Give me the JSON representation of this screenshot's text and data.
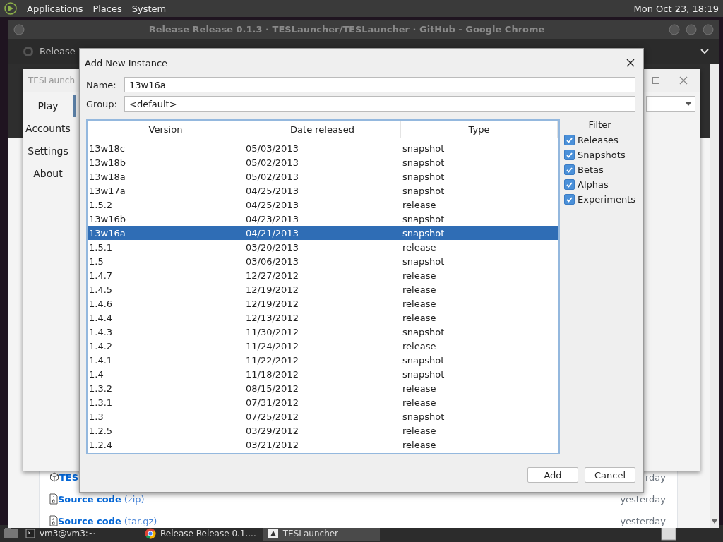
{
  "top_panel": {
    "menus": [
      "Applications",
      "Places",
      "System"
    ],
    "clock": "Mon Oct 23, 18:19"
  },
  "browser": {
    "title": "Release Release 0.1.3 · TESLauncher/TESLauncher · GitHub - Google Chrome",
    "tab": "Release",
    "assets": [
      {
        "kind": "package",
        "name": "TES",
        "time": "rday"
      },
      {
        "kind": "archive",
        "name": "Source code",
        "format": "(zip)",
        "time": "yesterday"
      },
      {
        "kind": "archive",
        "name": "Source code",
        "format": "(tar.gz)",
        "time": "yesterday"
      }
    ]
  },
  "launcher": {
    "title": "TESLaunch",
    "nav": [
      {
        "label": "Play",
        "selected": true
      },
      {
        "label": "Accounts",
        "selected": false
      },
      {
        "label": "Settings",
        "selected": false
      },
      {
        "label": "About",
        "selected": false
      }
    ]
  },
  "dialog": {
    "title": "Add New Instance",
    "fields": [
      {
        "label": "Name:",
        "value": "13w16a"
      },
      {
        "label": "Group:",
        "value": "<default>"
      }
    ],
    "table": {
      "columns": [
        "Version",
        "Date released",
        "Type"
      ],
      "rows": [
        {
          "cells": [
            "13w18c",
            "05/03/2013",
            "snapshot"
          ],
          "selected": false
        },
        {
          "cells": [
            "13w18b",
            "05/02/2013",
            "snapshot"
          ],
          "selected": false
        },
        {
          "cells": [
            "13w18a",
            "05/02/2013",
            "snapshot"
          ],
          "selected": false
        },
        {
          "cells": [
            "13w17a",
            "04/25/2013",
            "snapshot"
          ],
          "selected": false
        },
        {
          "cells": [
            "1.5.2",
            "04/25/2013",
            "release"
          ],
          "selected": false
        },
        {
          "cells": [
            "13w16b",
            "04/23/2013",
            "snapshot"
          ],
          "selected": false
        },
        {
          "cells": [
            "13w16a",
            "04/21/2013",
            "snapshot"
          ],
          "selected": true
        },
        {
          "cells": [
            "1.5.1",
            "03/20/2013",
            "release"
          ],
          "selected": false
        },
        {
          "cells": [
            "1.5",
            "03/06/2013",
            "snapshot"
          ],
          "selected": false
        },
        {
          "cells": [
            "1.4.7",
            "12/27/2012",
            "release"
          ],
          "selected": false
        },
        {
          "cells": [
            "1.4.5",
            "12/19/2012",
            "release"
          ],
          "selected": false
        },
        {
          "cells": [
            "1.4.6",
            "12/19/2012",
            "release"
          ],
          "selected": false
        },
        {
          "cells": [
            "1.4.4",
            "12/13/2012",
            "release"
          ],
          "selected": false
        },
        {
          "cells": [
            "1.4.3",
            "11/30/2012",
            "snapshot"
          ],
          "selected": false
        },
        {
          "cells": [
            "1.4.2",
            "11/24/2012",
            "release"
          ],
          "selected": false
        },
        {
          "cells": [
            "1.4.1",
            "11/22/2012",
            "snapshot"
          ],
          "selected": false
        },
        {
          "cells": [
            "1.4",
            "11/18/2012",
            "snapshot"
          ],
          "selected": false
        },
        {
          "cells": [
            "1.3.2",
            "08/15/2012",
            "release"
          ],
          "selected": false
        },
        {
          "cells": [
            "1.3.1",
            "07/31/2012",
            "release"
          ],
          "selected": false
        },
        {
          "cells": [
            "1.3",
            "07/25/2012",
            "snapshot"
          ],
          "selected": false
        },
        {
          "cells": [
            "1.2.5",
            "03/29/2012",
            "release"
          ],
          "selected": false
        },
        {
          "cells": [
            "1.2.4",
            "03/21/2012",
            "release"
          ],
          "selected": false
        }
      ]
    },
    "filter": {
      "title": "Filter",
      "options": [
        {
          "label": "Releases",
          "checked": true
        },
        {
          "label": "Snapshots",
          "checked": true
        },
        {
          "label": "Betas",
          "checked": true
        },
        {
          "label": "Alphas",
          "checked": true
        },
        {
          "label": "Experiments",
          "checked": true
        }
      ]
    },
    "buttons": [
      "Add",
      "Cancel"
    ]
  },
  "taskbar": {
    "items": [
      {
        "kind": "terminal",
        "label": "vm3@vm3:~",
        "selected": false
      },
      {
        "kind": "browser",
        "label": "Release Release 0.1....",
        "selected": false
      },
      {
        "kind": "app",
        "label": "TESLauncher",
        "selected": true
      }
    ]
  }
}
